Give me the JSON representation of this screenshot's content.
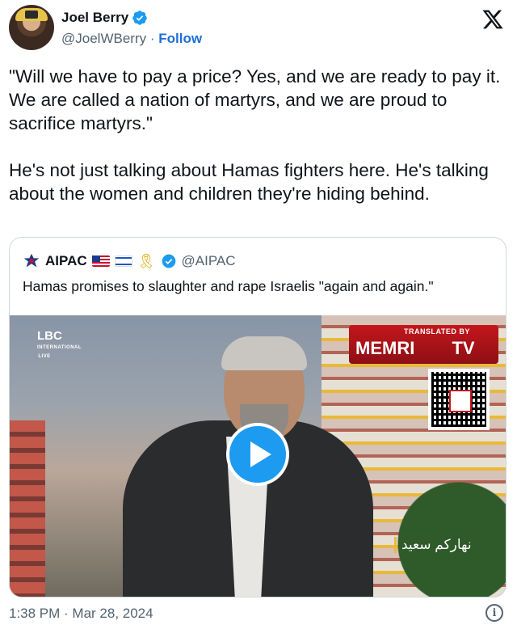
{
  "author": {
    "name": "Joel Berry",
    "handle": "@JoelWBerry",
    "separator": "·",
    "follow_label": "Follow"
  },
  "tweet": {
    "text": "\"Will we have to pay a price? Yes, and we are ready to pay it. We are called a nation of martyrs, and we are proud to sacrifice martyrs.\"\n\nHe's not just talking about Hamas fighters here. He's talking about the women and children they're hiding behind.",
    "timestamp": "1:38 PM · Mar 28, 2024"
  },
  "quoted_tweet": {
    "name": "AIPAC",
    "handle": "@AIPAC",
    "text": "Hamas promises to slaughter and rape Israelis \"again and again.\"",
    "video": {
      "channel_logo": "LBC",
      "channel_sub": "INTERNATIONAL",
      "live_label": "LIVE",
      "translated_by": "TRANSLATED BY",
      "memri_label": "MEMRI",
      "memri_tv": "TV",
      "arabic_caption": "نهاركم سعيد"
    }
  },
  "icons": {
    "verified": "verified-badge-icon",
    "x_logo": "x-logo-icon",
    "play": "play-icon",
    "info": "info-icon"
  },
  "colors": {
    "accent": "#1d9bf0",
    "follow": "#1d6fd8",
    "memri_red": "#c4161c"
  }
}
